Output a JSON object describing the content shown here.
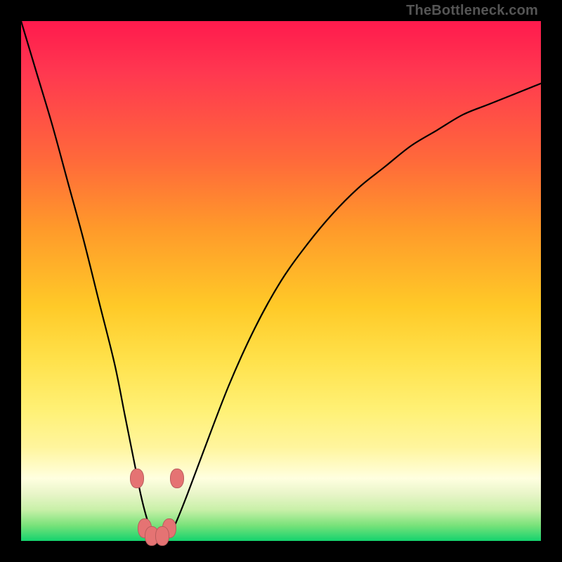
{
  "watermark": "TheBottleneck.com",
  "colors": {
    "frame": "#000000",
    "curve": "#000000",
    "marker_fill": "#e57373",
    "marker_stroke": "#b85c5c"
  },
  "chart_data": {
    "type": "line",
    "title": "",
    "xlabel": "",
    "ylabel": "",
    "xlim": [
      0,
      100
    ],
    "ylim": [
      0,
      100
    ],
    "grid": false,
    "background": "vertical-gradient red→yellow→green (top=high bottleneck, bottom=low)",
    "series": [
      {
        "name": "bottleneck-curve",
        "x": [
          0,
          3,
          6,
          9,
          12,
          15,
          18,
          20,
          22,
          23,
          24,
          25,
          26,
          27,
          28,
          29,
          30,
          32,
          35,
          40,
          45,
          50,
          55,
          60,
          65,
          70,
          75,
          80,
          85,
          90,
          95,
          100
        ],
        "values": [
          100,
          90,
          80,
          69,
          58,
          46,
          34,
          24,
          14,
          9,
          5,
          2,
          1,
          1,
          1,
          2,
          4,
          9,
          17,
          30,
          41,
          50,
          57,
          63,
          68,
          72,
          76,
          79,
          82,
          84,
          86,
          88
        ]
      }
    ],
    "markers": [
      {
        "name": "left-shoulder-upper",
        "x": 22.3,
        "y": 12
      },
      {
        "name": "right-shoulder-upper",
        "x": 30.0,
        "y": 12
      },
      {
        "name": "left-bottom",
        "x": 23.8,
        "y": 2.5
      },
      {
        "name": "right-bottom",
        "x": 28.5,
        "y": 2.5
      },
      {
        "name": "mid-left-bottom",
        "x": 25.2,
        "y": 1
      },
      {
        "name": "mid-right-bottom",
        "x": 27.2,
        "y": 1
      }
    ]
  }
}
